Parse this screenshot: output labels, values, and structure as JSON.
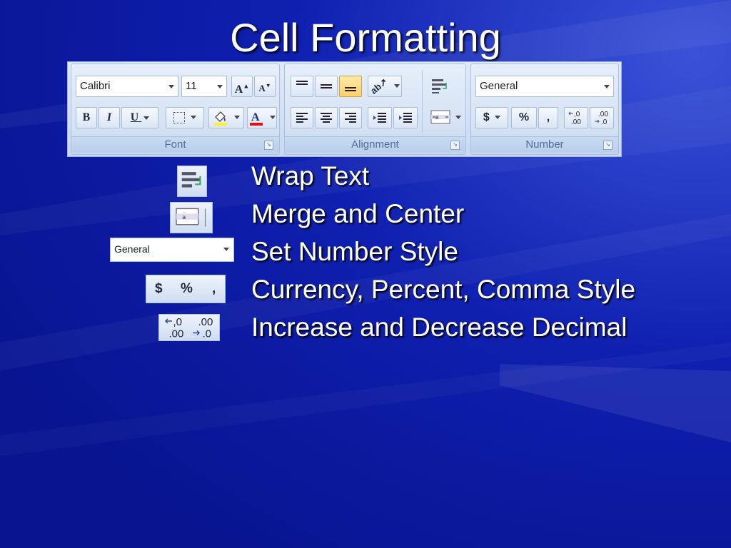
{
  "title": "Cell Formatting",
  "ribbon": {
    "font_group": {
      "label": "Font",
      "font_name": "Calibri",
      "font_size": "11",
      "bold": "B",
      "italic": "I",
      "underline": "U"
    },
    "alignment_group": {
      "label": "Alignment"
    },
    "number_group": {
      "label": "Number",
      "format": "General",
      "currency": "$",
      "percent": "%",
      "comma": ","
    }
  },
  "list": {
    "items": [
      {
        "text": "Wrap Text",
        "icon": "wrap-text-icon"
      },
      {
        "text": "Merge and Center",
        "icon": "merge-center-icon"
      },
      {
        "text": "Set Number Style",
        "icon": "number-format-combo",
        "combo_value": "General"
      },
      {
        "text": "Currency, Percent, Comma Style",
        "icon": "currency-percent-comma-icons",
        "labels": [
          "$",
          "%",
          ","
        ]
      },
      {
        "text": "Increase and Decrease Decimal",
        "icon": "decimal-icons"
      }
    ]
  },
  "colors": {
    "background": "#0a1aa8",
    "text": "#ffffff",
    "ribbon": "#d4e2f4"
  }
}
